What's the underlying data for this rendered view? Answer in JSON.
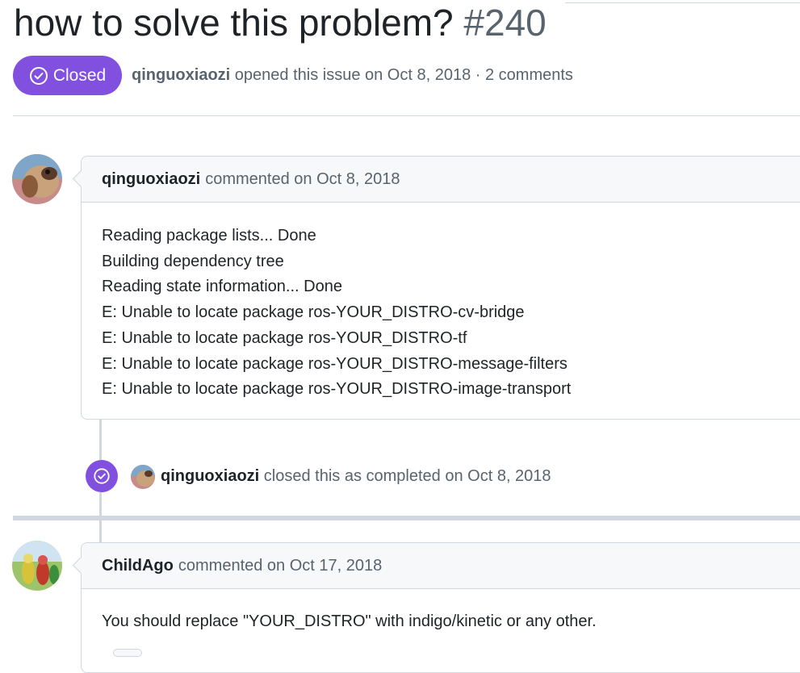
{
  "issue": {
    "title": "how to solve this problem?",
    "number": "#240",
    "status": "Closed",
    "status_color": "#8250df",
    "author": "qinguoxiaozi",
    "opened_text": "opened this issue on Oct 8, 2018 · 2 comments"
  },
  "comments": [
    {
      "author": "qinguoxiaozi",
      "meta": "commented on Oct 8, 2018",
      "lines": [
        "Reading package lists... Done",
        "Building dependency tree",
        "Reading state information... Done",
        "E: Unable to locate package ros-YOUR_DISTRO-cv-bridge",
        "E: Unable to locate package ros-YOUR_DISTRO-tf",
        "E: Unable to locate package ros-YOUR_DISTRO-message-filters",
        "E: Unable to locate package ros-YOUR_DISTRO-image-transport"
      ]
    },
    {
      "author": "ChildAgo",
      "meta": "commented on Oct 17, 2018",
      "lines": [
        "You should replace \"YOUR_DISTRO\" with indigo/kinetic or any other."
      ]
    }
  ],
  "event": {
    "actor": "qinguoxiaozi",
    "text": "closed this as completed on Oct 8, 2018",
    "icon": "check-circle-icon"
  }
}
